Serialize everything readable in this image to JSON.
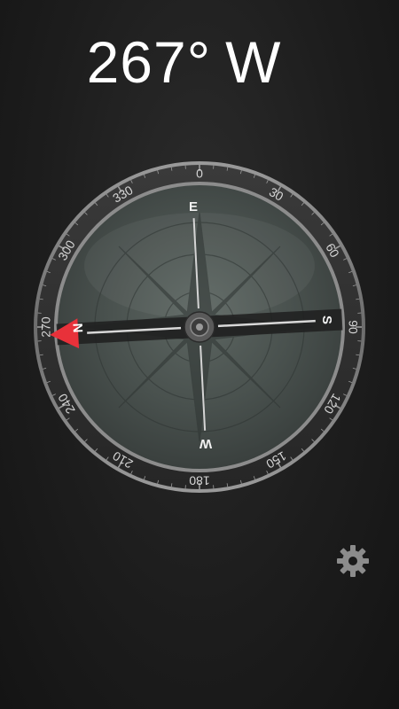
{
  "heading": {
    "degrees": "267°",
    "direction": "W"
  },
  "compass": {
    "dial_labels": [
      "0",
      "30",
      "60",
      "90",
      "120",
      "150",
      "180",
      "210",
      "240",
      "270",
      "300",
      "330"
    ],
    "cardinals": {
      "north": "N",
      "east": "E",
      "south": "S",
      "west": "W"
    },
    "needle_color": "#e8313a",
    "bezel_color": "#8a8a8a",
    "face_color": "#4a524f"
  },
  "settings": {
    "icon": "gear-icon"
  }
}
